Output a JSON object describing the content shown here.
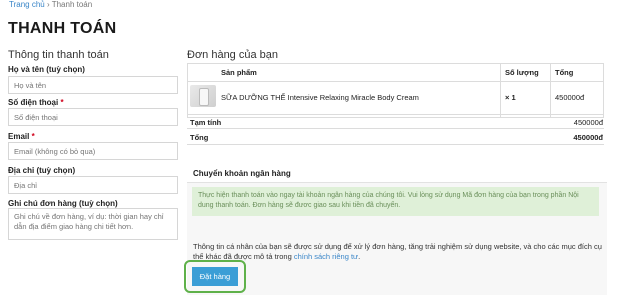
{
  "breadcrumb": {
    "home": "Trang chủ",
    "separator": "›",
    "current": "Thanh toán"
  },
  "page_title": "THANH TOÁN",
  "billing": {
    "heading": "Thông tin thanh toán",
    "name": {
      "label": "Họ và tên (tuỳ chọn)",
      "placeholder": "Họ và tên"
    },
    "phone": {
      "label": "Số điện thoại",
      "required_mark": "*",
      "placeholder": "Số điện thoại"
    },
    "email": {
      "label": "Email",
      "required_mark": "*",
      "placeholder": "Email (không có bỏ qua)"
    },
    "address": {
      "label": "Địa chỉ (tuỳ chọn)",
      "placeholder": "Địa chỉ"
    },
    "note": {
      "label": "Ghi chú đơn hàng (tuỳ chọn)",
      "placeholder": "Ghi chú về đơn hàng, ví dụ: thời gian hay chỉ dẫn địa điểm giao hàng chi tiết hơn."
    }
  },
  "order": {
    "heading": "Đơn hàng của bạn",
    "columns": {
      "product": "Sản phẩm",
      "quantity": "Số lượng",
      "total": "Tổng"
    },
    "items": [
      {
        "name": "SỮA DƯỠNG THỂ Intensive Relaxing Miracle Body Cream",
        "quantity": "× 1",
        "price": "450000đ",
        "image_icon": "product-thumbnail"
      }
    ],
    "subtotal_label": "Tạm tính",
    "subtotal_value": "450000đ",
    "total_label": "Tổng",
    "total_value": "450000đ"
  },
  "payment": {
    "method_title": "Chuyển khoản ngân hàng",
    "description": "Thực hiện thanh toán vào ngay tài khoản ngân hàng của chúng tôi. Vui lòng sử dụng Mã đơn hàng của bạn trong phần Nội dung thanh toán. Đơn hàng sẽ đươc giao sau khi tiền đã chuyển.",
    "privacy_text": "Thông tin cá nhân của bạn sẽ được sử dụng để xử lý đơn hàng, tăng trải nghiệm sử dụng website, và cho các mục đích cụ thể khác đã được mô tả trong ",
    "privacy_link": "chính sách riêng tư",
    "privacy_end": ".",
    "place_order_label": "Đặt hàng"
  },
  "colors": {
    "accent": "#3b9ed6",
    "link": "#3a86c8",
    "notice_bg": "#dff0d8",
    "highlight_ring": "#5fb14a",
    "required": "#d0011b"
  }
}
